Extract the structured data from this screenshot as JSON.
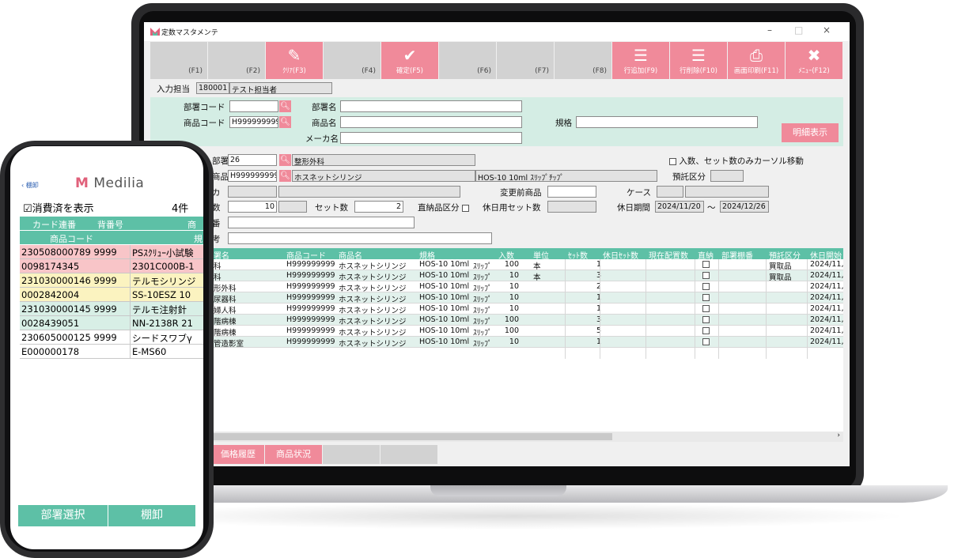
{
  "app": {
    "window_title": "定数マスタメンテ",
    "window_controls": [
      "–",
      "□",
      "×"
    ]
  },
  "fkeys": [
    {
      "label": "(F1)",
      "icon": "",
      "style": "gray"
    },
    {
      "label": "(F2)",
      "icon": "",
      "style": "gray"
    },
    {
      "label": "ｸﾘｱ(F3)",
      "icon": "eraser-icon",
      "style": "pink"
    },
    {
      "label": "(F4)",
      "icon": "",
      "style": "gray"
    },
    {
      "label": "確定(F5)",
      "icon": "check-icon",
      "style": "pink"
    },
    {
      "label": "(F6)",
      "icon": "",
      "style": "gray"
    },
    {
      "label": "(F7)",
      "icon": "",
      "style": "gray"
    },
    {
      "label": "(F8)",
      "icon": "",
      "style": "gray"
    },
    {
      "label": "行追加(F9)",
      "icon": "add-row-icon",
      "style": "pink"
    },
    {
      "label": "行削除(F10)",
      "icon": "delete-row-icon",
      "style": "pink"
    },
    {
      "label": "画面印刷(F11)",
      "icon": "print-icon",
      "style": "pink"
    },
    {
      "label": "ﾒﾆｭｰ(F12)",
      "icon": "close-icon",
      "style": "pink"
    }
  ],
  "input_person": {
    "label": "入力担当",
    "code": "180001",
    "name": "テスト担当者"
  },
  "search": {
    "dept_code_label": "部署コード",
    "dept_code_value": "",
    "dept_name_label": "部署名",
    "dept_name_value": "",
    "product_code_label": "商品コード",
    "product_code_value": "H999999999",
    "product_name_label": "商品名",
    "product_name_value": "",
    "spec_label": "規格",
    "spec_value": "",
    "maker_label": "メーカ名",
    "maker_value": "",
    "detail_button": "明細表示"
  },
  "detail": {
    "dept_label": "部署",
    "dept_code": "26",
    "dept_name": "整形外科",
    "product_label": "商品",
    "product_code": "H999999999",
    "product_name": "ホスネットシリンジ",
    "product_spec": "HOS-10 10ml ｽﾘｯﾌﾟﾁｯﾌﾟ",
    "maker_label": "カ",
    "qty_label": "数",
    "qty_value": "10",
    "set_qty_label": "セット数",
    "set_qty_value": "2",
    "direct_label": "直納品区分",
    "holiday_set_label": "休日用セット数",
    "prev_product_label": "変更前商品",
    "case_label": "ケース",
    "holiday_period_label": "休日期間",
    "holiday_from": "2024/11/20",
    "holiday_tilde": "～",
    "holiday_to": "2024/12/26",
    "shelf_label": "番",
    "note_label": "考",
    "cursor_option_label": "入数、セット数のみカーソル移動",
    "consign_label": "預託区分"
  },
  "grid": {
    "headers": [
      "署名",
      "商品コード",
      "商品名",
      "規格",
      "入数",
      "単位",
      "ｾｯﾄ数",
      "休日ｾｯﾄ数",
      "現在配置数",
      "直納",
      "部署棚番",
      "預託区分",
      "休日開始"
    ],
    "rows": [
      {
        "dept": "科",
        "code": "H999999999",
        "name": "ホスネットシリンジ",
        "spec": "HOS-10 10ml",
        "tip": "ｽﾘｯﾌﾟ",
        "qty": "100",
        "unit": "本",
        "sets": "1",
        "consign": "買取品",
        "holiday": "2024/11,"
      },
      {
        "dept": "科",
        "code": "H999999999",
        "name": "ホスネットシリンジ",
        "spec": "HOS-10 10ml",
        "tip": "ｽﾘｯﾌﾟ",
        "qty": "10",
        "unit": "本",
        "sets": "3",
        "consign": "買取品",
        "holiday": "2024/11,"
      },
      {
        "dept": "形外科",
        "code": "H999999999",
        "name": "ホスネットシリンジ",
        "spec": "HOS-10 10ml",
        "tip": "ｽﾘｯﾌﾟ",
        "qty": "10",
        "unit": "",
        "sets": "2",
        "consign": "",
        "holiday": "2024/11,"
      },
      {
        "dept": "尿器科",
        "code": "H999999999",
        "name": "ホスネットシリンジ",
        "spec": "HOS-10 10ml",
        "tip": "ｽﾘｯﾌﾟ",
        "qty": "10",
        "unit": "",
        "sets": "1",
        "consign": "",
        "holiday": "2024/11,"
      },
      {
        "dept": "婦人科",
        "code": "H999999999",
        "name": "ホスネットシリンジ",
        "spec": "HOS-10 10ml",
        "tip": "ｽﾘｯﾌﾟ",
        "qty": "10",
        "unit": "",
        "sets": "1",
        "consign": "",
        "holiday": "2024/11,"
      },
      {
        "dept": "階病棟",
        "code": "H999999999",
        "name": "ホスネットシリンジ",
        "spec": "HOS-10 10ml",
        "tip": "ｽﾘｯﾌﾟ",
        "qty": "100",
        "unit": "",
        "sets": "3",
        "consign": "",
        "holiday": "2024/11,"
      },
      {
        "dept": "階病棟",
        "code": "H999999999",
        "name": "ホスネットシリンジ",
        "spec": "HOS-10 10ml",
        "tip": "ｽﾘｯﾌﾟ",
        "qty": "100",
        "unit": "",
        "sets": "5",
        "consign": "",
        "holiday": "2024/11,"
      },
      {
        "dept": "管造影室",
        "code": "H999999999",
        "name": "ホスネットシリンジ",
        "spec": "HOS-10 10ml",
        "tip": "ｽﾘｯﾌﾟ",
        "qty": "10",
        "unit": "",
        "sets": "1",
        "consign": "",
        "holiday": "2024/11,"
      }
    ]
  },
  "bottom_tabs": [
    "価格履歴",
    "商品状況"
  ],
  "phone": {
    "back_label": "棚卸",
    "logo_text": "Medilia",
    "toggle_label": "消費済を表示",
    "count": "4件",
    "headers": {
      "card": "カード連番",
      "back_no": "背番号",
      "product_trunc": "商",
      "code": "商品コード",
      "spec_trunc": "規"
    },
    "rows": [
      {
        "left": "230508000789 9999",
        "right": "PSｽｸﾘｭｰ小試験",
        "color": "#f8c5c8"
      },
      {
        "left": "0098174345",
        "right": "2301C000B-1",
        "color": "#f8c5c8"
      },
      {
        "left": "231030000146 9999",
        "right": "テルモシリンジ",
        "color": "#fbf3c0"
      },
      {
        "left": "0002842004",
        "right": "SS-10ESZ 10",
        "color": "#fbf3c0"
      },
      {
        "left": "231030000145 9999",
        "right": "テルモ注射針",
        "color": "#d8efe6"
      },
      {
        "left": "0028439051",
        "right": "NN-2138R 21",
        "color": "#d8efe6"
      },
      {
        "left": "230605000125 9999",
        "right": "シードスワブγ",
        "color": "#ffffff"
      },
      {
        "left": "E000000178",
        "right": "E-MS60",
        "color": "#ffffff"
      }
    ],
    "footer_left": "部署選択",
    "footer_right": "棚卸"
  },
  "colors": {
    "accent_pink": "#f08a9a",
    "accent_teal": "#5dc0a6",
    "panel_green": "#d4ede4"
  }
}
